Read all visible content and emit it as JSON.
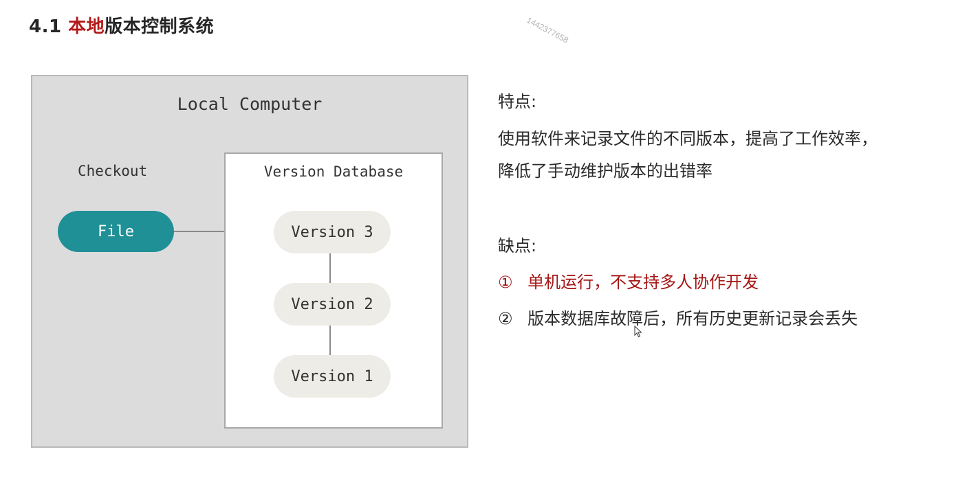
{
  "title": {
    "prefix": "4.1 ",
    "accent": "本地",
    "rest": "版本控制系统"
  },
  "watermark": "1442377658",
  "diagram": {
    "outer_label": "Local Computer",
    "checkout_label": "Checkout",
    "file_label": "File",
    "database_label": "Version Database",
    "versions": [
      "Version 3",
      "Version 2",
      "Version 1"
    ],
    "colors": {
      "file": "#1f9096",
      "version": "#eeece6",
      "outer": "#dcdcdc"
    }
  },
  "features": {
    "heading": "特点:",
    "line1": "使用软件来记录文件的不同版本，提高了工作效率，",
    "line2": "降低了手动维护版本的出错率"
  },
  "drawbacks": {
    "heading": "缺点:",
    "item1_marker": "①",
    "item1_text": "单机运行，不支持多人协作开发",
    "item2_marker": "②",
    "item2_text": "版本数据库故障后，所有历史更新记录会丢失"
  }
}
